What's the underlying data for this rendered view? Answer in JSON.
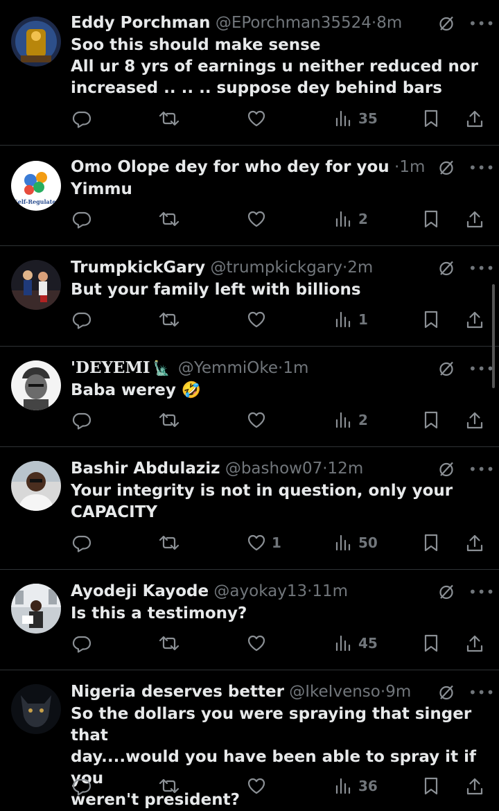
{
  "tweets": [
    {
      "name": "Eddy Porchman",
      "handle": "@EPorchman35524",
      "time": "8m",
      "text": [
        "Soo this should make sense",
        "All ur 8 yrs of earnings u neither reduced nor",
        "increased .. .. .. suppose dey behind bars"
      ],
      "likes": "",
      "views": "35"
    },
    {
      "name": "Omo Olope dey for who dey for you",
      "handle": "",
      "time": "1m",
      "avatar_label": "Self-Regulate!",
      "text": [
        "Yimmu"
      ],
      "likes": "",
      "views": "2"
    },
    {
      "name": "TrumpkickGary",
      "handle": "@trumpkickgary",
      "time": "2m",
      "text": [
        "But your family left with billions"
      ],
      "likes": "",
      "views": "1"
    },
    {
      "name": "'DEYEMI",
      "handle": "@YemmiOke",
      "time": "1m",
      "text": [
        "Baba werey 🤣"
      ],
      "likes": "",
      "views": "2"
    },
    {
      "name": "Bashir Abdulaziz",
      "handle": "@bashow07",
      "time": "12m",
      "text": [
        "Your integrity is not in question, only your",
        "CAPACITY"
      ],
      "likes": "1",
      "views": "50"
    },
    {
      "name": "Ayodeji Kayode",
      "handle": "@ayokay13",
      "time": "11m",
      "text": [
        "Is this a testimony?"
      ],
      "likes": "",
      "views": "45"
    },
    {
      "name": "Nigeria deserves better",
      "handle": "@IkeIvenso",
      "time": "9m",
      "text": [
        "So the dollars you were spraying that singer that",
        "day....would you have been able to spray it if you",
        "weren't president?"
      ],
      "likes": "",
      "views": "36"
    }
  ],
  "separator": "·",
  "icons": {
    "reply": "reply-icon",
    "retweet": "retweet-icon",
    "like": "heart-icon",
    "views": "views-icon",
    "bookmark": "bookmark-icon",
    "share": "share-icon",
    "grok": "grok-icon",
    "more": "more-icon"
  },
  "colors": {
    "background": "#000000",
    "text": "#e7e9ea",
    "secondary": "#71767b",
    "divider": "#2f3336"
  }
}
